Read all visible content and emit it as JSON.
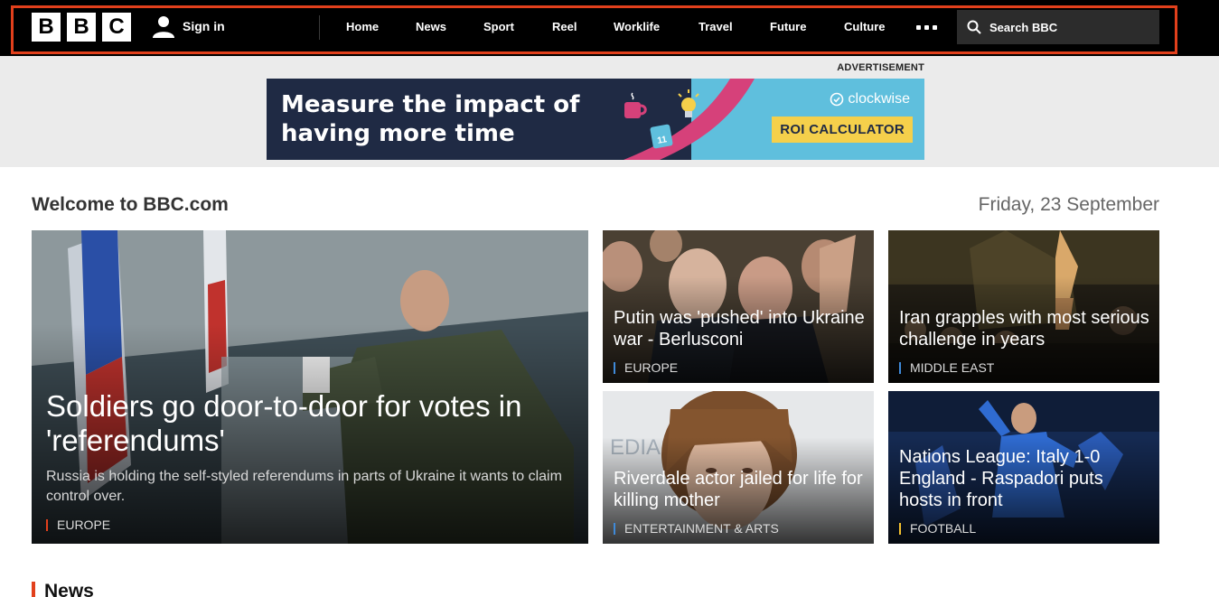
{
  "header": {
    "logo_letters": [
      "B",
      "B",
      "C"
    ],
    "sign_in": "Sign in",
    "nav": [
      "Home",
      "News",
      "Sport",
      "Reel",
      "Worklife",
      "Travel",
      "Future",
      "Culture"
    ],
    "more_icon": "ellipsis-icon",
    "search_label": "Search BBC",
    "outline_color": "#e2401c"
  },
  "ad": {
    "label": "ADVERTISEMENT",
    "headline_line1": "Measure the impact of",
    "headline_line2": "having more time",
    "brand": "clockwise",
    "cta": "ROI CALCULATOR",
    "calendar_day": "11"
  },
  "welcome": {
    "title": "Welcome to BBC.com",
    "date": "Friday, 23 September"
  },
  "stories": {
    "lead": {
      "headline": "Soldiers go door-to-door for votes in 'referendums'",
      "summary": "Russia is holding the self-styled referendums in parts of Ukraine it wants to claim control over.",
      "tag": "EUROPE"
    },
    "card1": {
      "headline": "Putin was 'pushed' into Ukraine war - Berlusconi",
      "tag": "EUROPE"
    },
    "card2": {
      "headline": "Iran grapples with most serious challenge in years",
      "tag": "MIDDLE EAST"
    },
    "card3": {
      "headline": "Riverdale actor jailed for life for killing mother",
      "tag": "ENTERTAINMENT & ARTS"
    },
    "card4": {
      "headline": "Nations League: Italy 1-0 England - Raspadori puts hosts in front",
      "tag": "FOOTBALL"
    }
  },
  "section": {
    "title": "News"
  },
  "colors": {
    "accent": "#e2401c",
    "topbar": "#000000",
    "ad_bg": "#1f2a44",
    "cta": "#f5d04b"
  }
}
